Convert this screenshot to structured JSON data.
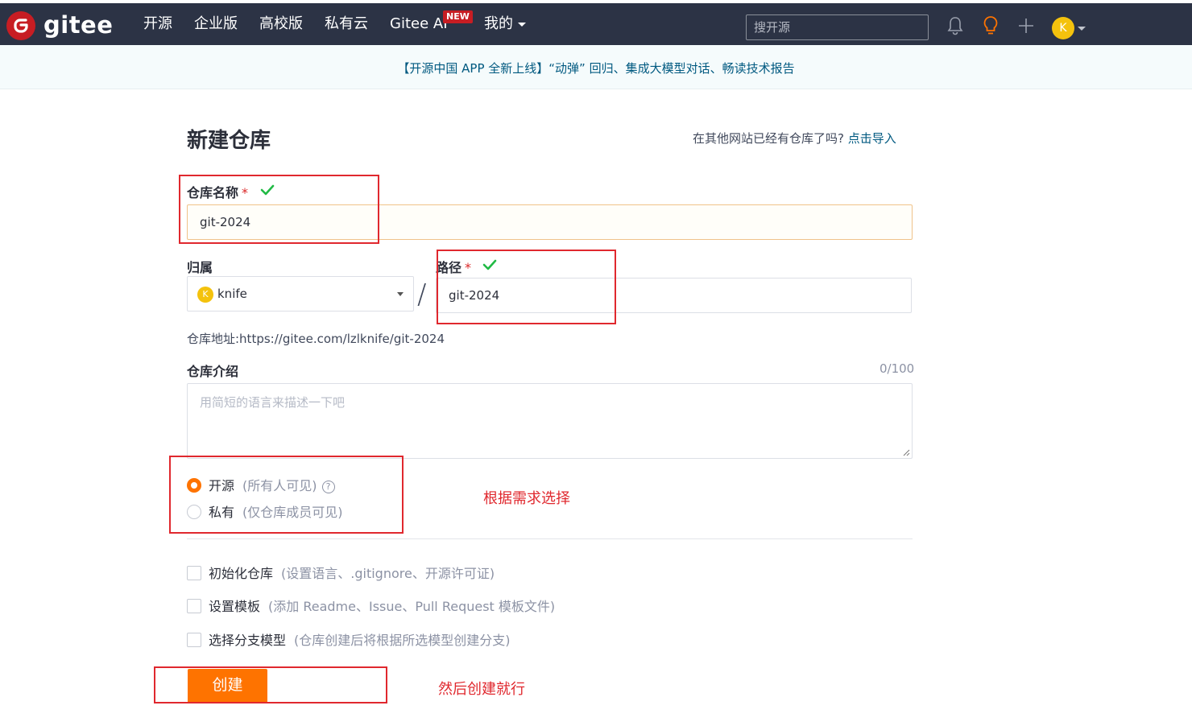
{
  "nav": {
    "logo_text": "gitee",
    "items": [
      "开源",
      "企业版",
      "高校版",
      "私有云",
      "Gitee AI",
      "我的"
    ],
    "new_badge": "NEW",
    "search_placeholder": "搜开源",
    "avatar_initial": "K"
  },
  "banner": {
    "text": "【开源中国 APP 全新上线】“动弹” 回归、集成大模型对话、畅读技术报告"
  },
  "page": {
    "title": "新建仓库",
    "import_prompt": "在其他网站已经有仓库了吗?",
    "import_link": "点击导入"
  },
  "form": {
    "repo_name_label": "仓库名称",
    "required_mark": "*",
    "repo_name_value": "git-2024",
    "owner_label": "归属",
    "owner_avatar_initial": "K",
    "owner_value": "knife",
    "slash": "/",
    "path_label": "路径",
    "path_value": "git-2024",
    "repo_address": "仓库地址:https://gitee.com/lzlknife/git-2024",
    "intro_label": "仓库介绍",
    "intro_counter": "0/100",
    "intro_placeholder": "用简短的语言来描述一下吧",
    "visibility": {
      "public_label": "开源",
      "public_hint": "(所有人可见)",
      "help_glyph": "?",
      "private_label": "私有",
      "private_hint": "(仅仓库成员可见)",
      "selected": "public"
    },
    "options": [
      {
        "label": "初始化仓库",
        "hint": "(设置语言、.gitignore、开源许可证)",
        "checked": false
      },
      {
        "label": "设置模板",
        "hint": "(添加 Readme、Issue、Pull Request 模板文件)",
        "checked": false
      },
      {
        "label": "选择分支模型",
        "hint": "(仓库创建后将根据所选模型创建分支)",
        "checked": false
      }
    ],
    "create_button": "创建"
  },
  "annotations": {
    "choose_note": "根据需求选择",
    "create_note": "然后创建就行",
    "color": "#e0282e"
  },
  "colors": {
    "navbar": "#2c3345",
    "brand_red": "#c71d23",
    "accent_orange": "#fe7300",
    "link": "#005980",
    "success_green": "#21ba45"
  }
}
